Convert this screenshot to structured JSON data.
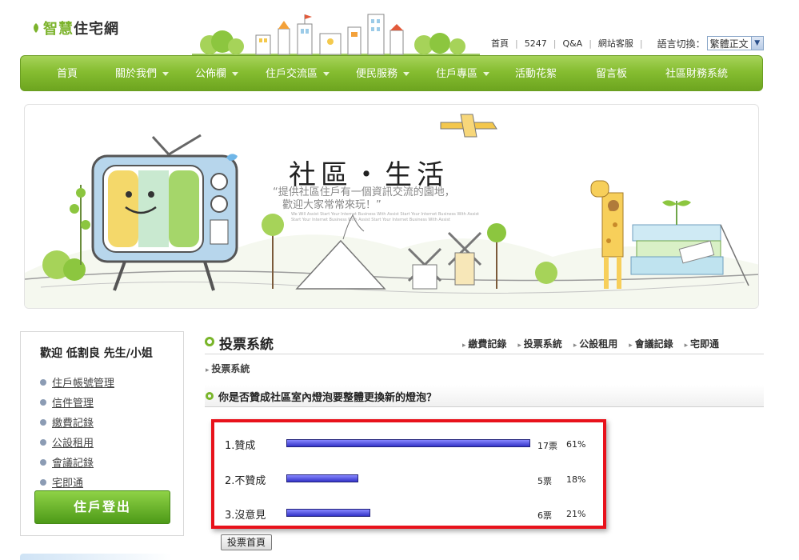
{
  "site": {
    "logo_prefix": "智慧",
    "logo_suffix": "住宅網"
  },
  "top_links": [
    "首頁",
    "5247",
    "Q&A",
    "網站客服"
  ],
  "language": {
    "label": "語言切換：",
    "selected": "繁體正文"
  },
  "nav": [
    {
      "label": "首頁",
      "dropdown": false
    },
    {
      "label": "關於我們",
      "dropdown": true
    },
    {
      "label": "公佈欄",
      "dropdown": true
    },
    {
      "label": "住戶交流區",
      "dropdown": true
    },
    {
      "label": "便民服務",
      "dropdown": true
    },
    {
      "label": "住戶專區",
      "dropdown": true
    },
    {
      "label": "活動花絮",
      "dropdown": false
    },
    {
      "label": "留言板",
      "dropdown": false
    },
    {
      "label": "社區財務系統",
      "dropdown": false
    }
  ],
  "banner": {
    "title": "社區・生活",
    "subtitle_line1": "“提供社區住戶有一個資訊交流的園地，",
    "subtitle_line2": "歡迎大家常常來玩！”",
    "small_text": "We Will Assist Start Your Internet Business With Assist Start Your Internet Business With Assist Start Your Internet Business With Assist Start Your Internet Business With Assist",
    "memo": "MEMO"
  },
  "sidebar": {
    "welcome": "歡迎 低割良 先生/小姐",
    "items": [
      "住戶帳號管理",
      "信件管理",
      "繳費記錄",
      "公設租用",
      "會議記錄",
      "宅即通"
    ],
    "logout": "住戶登出"
  },
  "main": {
    "section_title": "投票系統",
    "subnav": [
      "繳費記錄",
      "投票系統",
      "公設租用",
      "會議記錄",
      "宅即通"
    ],
    "breadcrumb": "投票系統",
    "question": "你是否贊成社區室內燈泡要整體更換新的燈泡？",
    "options": [
      {
        "label": "1.贊成",
        "votes": "17票",
        "percent": "61%",
        "fraction": 0.61
      },
      {
        "label": "2.不贊成",
        "votes": "5票",
        "percent": "18%",
        "fraction": 0.18
      },
      {
        "label": "3.沒意見",
        "votes": "6票",
        "percent": "21%",
        "fraction": 0.21
      }
    ],
    "home_button": "投票首頁"
  },
  "colors": {
    "nav_green": "#86bd31",
    "highlight_red": "#e8121b",
    "bar_blue": "#3333c8"
  }
}
